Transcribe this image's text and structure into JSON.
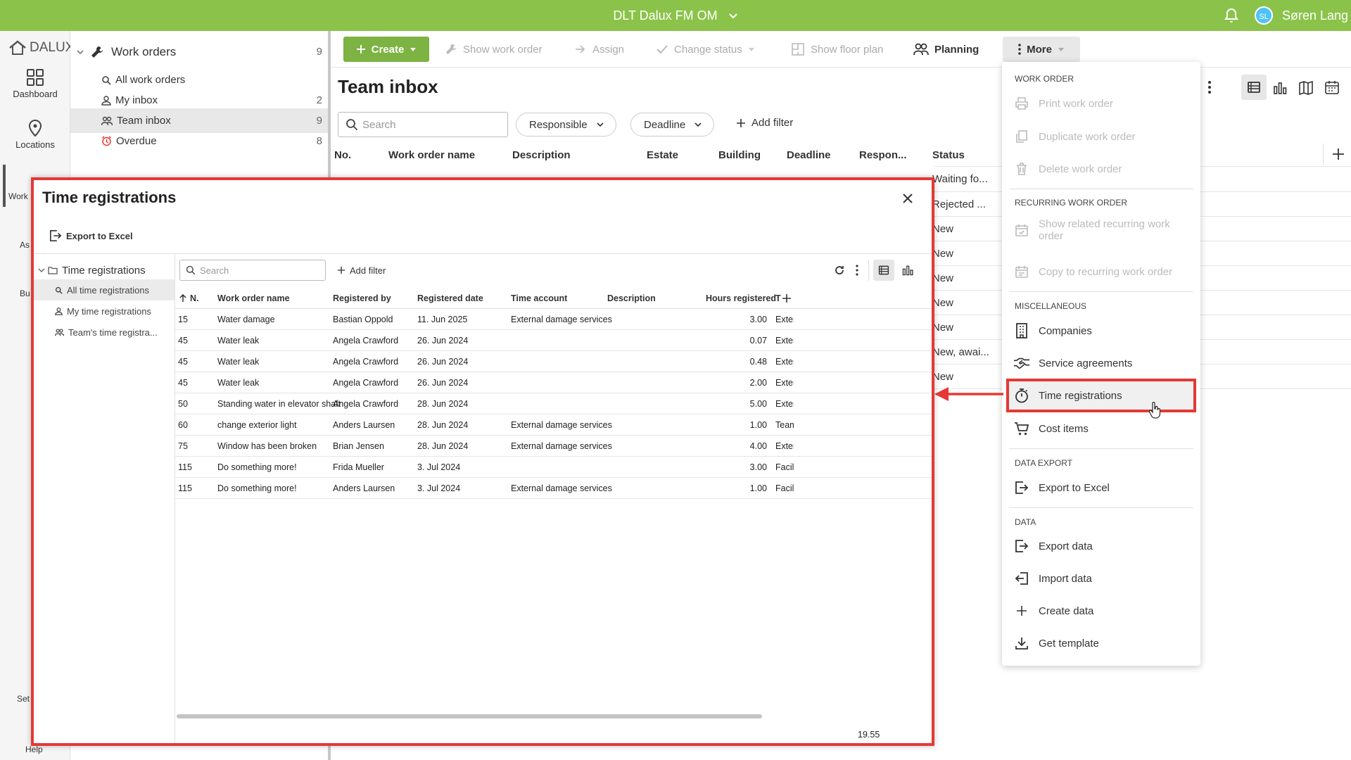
{
  "topbar": {
    "title": "DLT Dalux FM OM",
    "avatar_initials": "SL",
    "user_name": "Søren Lang"
  },
  "rail": {
    "logo_text": "DALUX",
    "items": [
      {
        "label": "Dashboard",
        "icon": "dashboard-icon"
      },
      {
        "label": "Locations",
        "icon": "location-pin-icon"
      }
    ],
    "partial_labels": [
      "Work",
      "As",
      "Bu",
      "Set",
      "Help"
    ]
  },
  "sidebar": {
    "section_title": "Work orders",
    "section_count": "9",
    "items": [
      {
        "label": "All work orders",
        "count": "",
        "icon": "search-icon"
      },
      {
        "label": "My inbox",
        "count": "2",
        "icon": "person-icon"
      },
      {
        "label": "Team inbox",
        "count": "9",
        "icon": "people-icon"
      },
      {
        "label": "Overdue",
        "count": "8",
        "icon": "alarm-clock-icon"
      }
    ]
  },
  "toolbar": {
    "create": "Create",
    "show_work_order": "Show work order",
    "assign": "Assign",
    "change_status": "Change status",
    "show_floor_plan": "Show floor plan",
    "planning": "Planning",
    "more": "More"
  },
  "inbox": {
    "title": "Team inbox",
    "search_placeholder": "Search",
    "filters": [
      "Responsible",
      "Deadline"
    ],
    "add_filter": "Add filter",
    "columns": [
      "No.",
      "Work order name",
      "Description",
      "Estate",
      "Building",
      "Deadline",
      "Respon...",
      "Status"
    ],
    "status_values": [
      "Waiting fo...",
      "Rejected ...",
      "New",
      "New",
      "New",
      "New",
      "New",
      "New, awai...",
      "New"
    ]
  },
  "dropdown": {
    "sections": [
      {
        "title": "WORK ORDER",
        "items": [
          {
            "label": "Print work order",
            "icon": "printer-icon",
            "disabled": true
          },
          {
            "label": "Duplicate work order",
            "icon": "duplicate-icon",
            "disabled": true
          },
          {
            "label": "Delete work order",
            "icon": "trash-icon",
            "disabled": true
          }
        ]
      },
      {
        "title": "RECURRING WORK ORDER",
        "items": [
          {
            "label": "Show related recurring work order",
            "icon": "calendar-recurring-icon",
            "disabled": true
          },
          {
            "label": "Copy to recurring work order",
            "icon": "calendar-copy-icon",
            "disabled": true
          }
        ]
      },
      {
        "title": "MISCELLANEOUS",
        "items": [
          {
            "label": "Companies",
            "icon": "building-icon",
            "disabled": false
          },
          {
            "label": "Service agreements",
            "icon": "handshake-icon",
            "disabled": false
          },
          {
            "label": "Time registrations",
            "icon": "stopwatch-icon",
            "disabled": false
          },
          {
            "label": "Cost items",
            "icon": "cart-icon",
            "disabled": false
          }
        ]
      },
      {
        "title": "DATA EXPORT",
        "items": [
          {
            "label": "Export to Excel",
            "icon": "export-icon",
            "disabled": false
          }
        ]
      },
      {
        "title": "DATA",
        "items": [
          {
            "label": "Export data",
            "icon": "export-icon",
            "disabled": false
          },
          {
            "label": "Import data",
            "icon": "import-icon",
            "disabled": false
          },
          {
            "label": "Create data",
            "icon": "plus-icon",
            "disabled": false
          },
          {
            "label": "Get template",
            "icon": "download-icon",
            "disabled": false
          }
        ]
      }
    ]
  },
  "modal": {
    "title": "Time registrations",
    "export_label": "Export to Excel",
    "tree": {
      "root": "Time registrations",
      "items": [
        "All time registrations",
        "My time registrations",
        "Team's time registra..."
      ]
    },
    "grid": {
      "search_placeholder": "Search",
      "add_filter": "Add filter",
      "columns": [
        "N.",
        "Work order name",
        "Registered by",
        "Registered date",
        "Time account",
        "Description",
        "Hours registered",
        "T"
      ],
      "rows": [
        [
          "15",
          "Water damage",
          "Bastian Oppold",
          "11. Jun 2025",
          "External damage services",
          "",
          "3.00",
          "Exter"
        ],
        [
          "45",
          "Water leak",
          "Angela Crawford",
          "26. Jun 2024",
          "",
          "",
          "0.07",
          "Exter"
        ],
        [
          "45",
          "Water leak",
          "Angela Crawford",
          "26. Jun 2024",
          "",
          "",
          "0.48",
          "Exter"
        ],
        [
          "45",
          "Water leak",
          "Angela Crawford",
          "26. Jun 2024",
          "",
          "",
          "2.00",
          "Exter"
        ],
        [
          "50",
          "Standing water in elevator shaft",
          "Angela Crawford",
          "28. Jun 2024",
          "",
          "",
          "5.00",
          "Exter"
        ],
        [
          "60",
          "change exterior light",
          "Anders Laursen",
          "28. Jun 2024",
          "External damage services",
          "",
          "1.00",
          "Team"
        ],
        [
          "75",
          "Window has been broken",
          "Brian Jensen",
          "28. Jun 2024",
          "External damage services",
          "",
          "4.00",
          "Exter"
        ],
        [
          "115",
          "Do something more!",
          "Frida Mueller",
          "3. Jul 2024",
          "",
          "",
          "3.00",
          "Facili"
        ],
        [
          "115",
          "Do something more!",
          "Anders Laursen",
          "3. Jul 2024",
          "External damage services",
          "",
          "1.00",
          "Facili"
        ]
      ],
      "total_hours": "19.55"
    }
  },
  "colors": {
    "brand_green": "#8bc34a",
    "highlight_red": "#e53935",
    "button_green": "#7cb342"
  }
}
